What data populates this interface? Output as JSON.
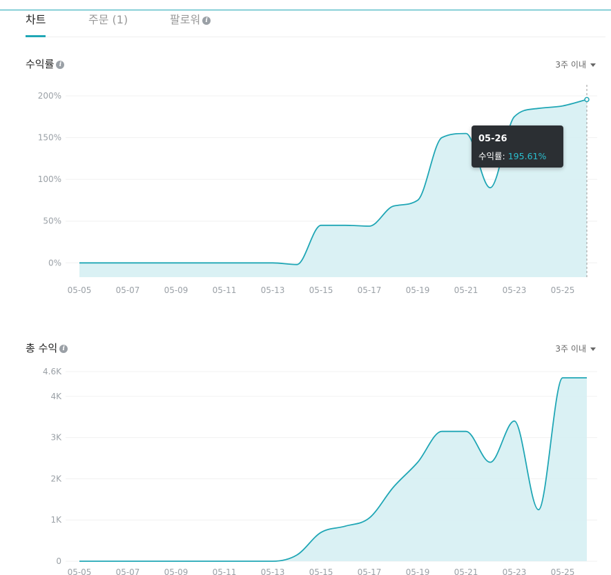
{
  "tabs": [
    {
      "label": "차트",
      "active": true
    },
    {
      "label": "주문 (1)",
      "active": false
    },
    {
      "label": "팔로워",
      "active": false,
      "info_icon": true
    }
  ],
  "accent_color": "#1fa6b5",
  "fill_color": "#d6f0f3",
  "charts": {
    "return_rate": {
      "title": "수익률",
      "period_label": "3주 이내"
    },
    "total_profit": {
      "title": "총 수익",
      "period_label": "3주 이내"
    }
  },
  "tooltip": {
    "date": "05-26",
    "label": "수익률",
    "value": "195.61%"
  },
  "chart_data": [
    {
      "type": "area",
      "title": "수익률",
      "x": [
        "05-05",
        "05-06",
        "05-07",
        "05-08",
        "05-09",
        "05-10",
        "05-11",
        "05-12",
        "05-13",
        "05-14",
        "05-15",
        "05-16",
        "05-17",
        "05-18",
        "05-19",
        "05-20",
        "05-21",
        "05-22",
        "05-23",
        "05-24",
        "05-25",
        "05-26"
      ],
      "x_tick_labels": [
        "05-05",
        "05-07",
        "05-09",
        "05-11",
        "05-13",
        "05-15",
        "05-17",
        "05-19",
        "05-21",
        "05-23",
        "05-25"
      ],
      "values": [
        0,
        0,
        0,
        0,
        0,
        0,
        0,
        0,
        0,
        -2,
        45,
        45,
        44,
        68,
        75,
        150,
        155,
        90,
        175,
        185,
        188,
        195.61
      ],
      "y_ticks": [
        0,
        50,
        100,
        150,
        200
      ],
      "y_tick_labels": [
        "0%",
        "50%",
        "100%",
        "150%",
        "200%"
      ],
      "ylim": [
        -13,
        205
      ],
      "grid": true,
      "highlighted_point": {
        "x": "05-26",
        "value": 195.61
      }
    },
    {
      "type": "area",
      "title": "총 수익",
      "x": [
        "05-05",
        "05-06",
        "05-07",
        "05-08",
        "05-09",
        "05-10",
        "05-11",
        "05-12",
        "05-13",
        "05-14",
        "05-15",
        "05-16",
        "05-17",
        "05-18",
        "05-19",
        "05-20",
        "05-21",
        "05-22",
        "05-23",
        "05-24",
        "05-25",
        "05-26"
      ],
      "x_tick_labels": [
        "05-05",
        "05-07",
        "05-09",
        "05-11",
        "05-13",
        "05-15",
        "05-17",
        "05-19",
        "05-21",
        "05-23",
        "05-25"
      ],
      "values": [
        0,
        0,
        0,
        0,
        0,
        0,
        0,
        0,
        0,
        150,
        700,
        850,
        1050,
        1800,
        2400,
        3150,
        3150,
        2400,
        3400,
        1250,
        4450,
        4450
      ],
      "y_ticks": [
        0,
        1000,
        2000,
        3000,
        4000,
        4600
      ],
      "y_tick_labels": [
        "0",
        "1K",
        "2K",
        "3K",
        "4K",
        "4.6K"
      ],
      "ylim": [
        0,
        4600
      ],
      "grid": true
    }
  ]
}
